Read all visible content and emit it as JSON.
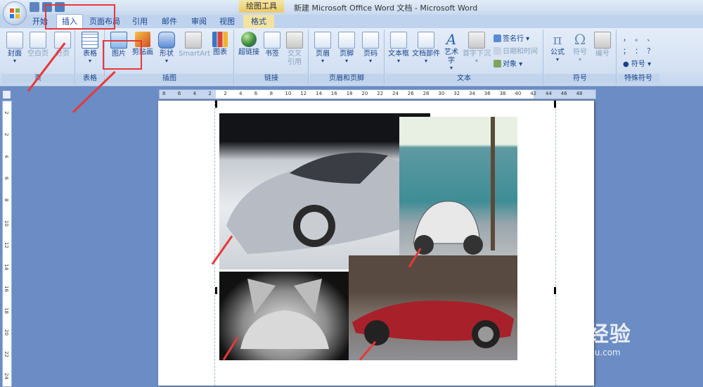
{
  "window": {
    "title": "新建 Microsoft Office Word 文档 - Microsoft Word",
    "context_tab_group": "绘图工具"
  },
  "tabs": [
    {
      "label": "开始"
    },
    {
      "label": "插入"
    },
    {
      "label": "页面布局"
    },
    {
      "label": "引用"
    },
    {
      "label": "邮件"
    },
    {
      "label": "审阅"
    },
    {
      "label": "视图"
    },
    {
      "label": "格式"
    }
  ],
  "ribbon": {
    "groups": {
      "pages": {
        "label": "页",
        "cover": "封面",
        "blank": "空白页",
        "break": "分页"
      },
      "table": {
        "label": "表格",
        "table": "表格"
      },
      "illustrations": {
        "label": "插图",
        "picture": "图片",
        "clipart": "剪贴画",
        "shapes": "形状",
        "smartart": "SmartArt",
        "chart": "图表"
      },
      "links": {
        "label": "链接",
        "hyperlink": "超链接",
        "bookmark": "书签",
        "crossref_1": "交叉",
        "crossref_2": "引用"
      },
      "header_footer": {
        "label": "页眉和页脚",
        "header": "页眉",
        "footer": "页脚",
        "page_number": "页码"
      },
      "text": {
        "label": "文本",
        "textbox": "文本框",
        "quickparts": "文档部件",
        "wordart": "艺术字",
        "dropcap": "首字下沉",
        "signature": "签名行",
        "datetime": "日期和时间",
        "object": "对象"
      },
      "symbols": {
        "label": "符号",
        "equation": "公式",
        "symbol": "符号",
        "numbering": "编号"
      },
      "special": {
        "label": "特殊符号",
        "row1": "，  。  、",
        "row2": "；  ：  ？",
        "symbol": "符号"
      }
    }
  },
  "ruler": {
    "h_ticks": [
      "8",
      "6",
      "4",
      "2",
      "2",
      "4",
      "6",
      "8",
      "10",
      "12",
      "14",
      "16",
      "18",
      "20",
      "22",
      "24",
      "26",
      "28",
      "30",
      "32",
      "34",
      "36",
      "38",
      "40",
      "42",
      "44",
      "46",
      "48"
    ],
    "v_ticks": [
      "2",
      "2",
      "4",
      "6",
      "8",
      "10",
      "12",
      "14",
      "16",
      "18",
      "20",
      "22",
      "24"
    ]
  },
  "watermark": {
    "main": "Bai  经验",
    "sub": "jingyan.baidu.com"
  },
  "colors": {
    "annotation": "#e8383a",
    "ribbon": "#d4e1f3",
    "tab_text": "#15428b"
  }
}
